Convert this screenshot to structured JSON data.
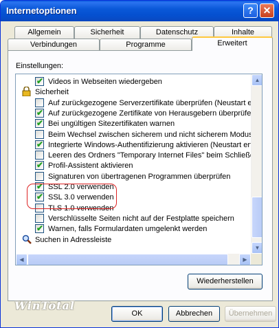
{
  "window": {
    "title": "Internetoptionen",
    "help_label": "?",
    "close_label": "✕"
  },
  "tabs_back": [
    "Allgemein",
    "Sicherheit",
    "Datenschutz",
    "Inhalte"
  ],
  "tabs_front": [
    "Verbindungen",
    "Programme",
    "Erweitert"
  ],
  "active_tab": "Erweitert",
  "settings_label": "Einstellungen:",
  "items": [
    {
      "type": "check",
      "checked": true,
      "label": "Videos in Webseiten wiedergeben"
    },
    {
      "type": "group",
      "icon": "lock-icon",
      "label": "Sicherheit"
    },
    {
      "type": "check",
      "checked": false,
      "label": "Auf zurückgezogene Serverzertifikate überprüfen (Neustart erf"
    },
    {
      "type": "check",
      "checked": true,
      "label": "Auf zurückgezogene Zertifikate von Herausgebern überprüfen"
    },
    {
      "type": "check",
      "checked": true,
      "label": "Bei ungültigen Sitezertifikaten warnen"
    },
    {
      "type": "check",
      "checked": false,
      "label": "Beim Wechsel zwischen sicherem und nicht sicherem Modus w"
    },
    {
      "type": "check",
      "checked": true,
      "label": "Integrierte Windows-Authentifizierung aktivieren (Neustart erfor"
    },
    {
      "type": "check",
      "checked": false,
      "label": "Leeren des Ordners \"Temporary Internet Files\" beim Schließer"
    },
    {
      "type": "check",
      "checked": true,
      "label": "Profil-Assistent aktivieren"
    },
    {
      "type": "check",
      "checked": false,
      "label": "Signaturen von übertragenen Programmen überprüfen"
    },
    {
      "type": "check",
      "checked": true,
      "label": "SSL 2.0 verwenden"
    },
    {
      "type": "check",
      "checked": true,
      "label": "SSL 3.0 verwenden"
    },
    {
      "type": "check",
      "checked": false,
      "label": "TLS 1.0 verwenden"
    },
    {
      "type": "check",
      "checked": false,
      "label": "Verschlüsselte Seiten nicht auf der Festplatte speichern"
    },
    {
      "type": "check",
      "checked": true,
      "label": "Warnen, falls Formulardaten umgelenkt werden"
    },
    {
      "type": "group",
      "icon": "search-icon",
      "label": "Suchen in Adressleiste"
    }
  ],
  "restore_button": "Wiederherstellen",
  "ok_button": "OK",
  "cancel_button": "Abbrechen",
  "apply_button": "Übernehmen",
  "watermark": "WinTotal"
}
